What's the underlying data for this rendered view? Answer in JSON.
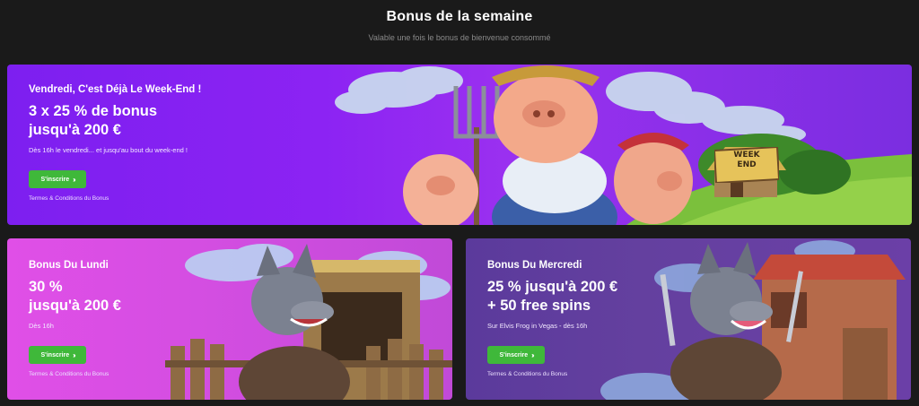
{
  "header": {
    "title": "Bonus de la semaine",
    "subtitle": "Valable une fois le bonus de bienvenue consommé"
  },
  "cards": [
    {
      "subtitle": "Vendredi, C'est Déjà Le Week-End !",
      "title_line1": "3 x 25 % de bonus",
      "title_line2": "jusqu'à 200 €",
      "description": "Dès 16h le vendredi... et jusqu'au bout du week-end !",
      "button_label": "S'inscrire",
      "terms_label": "Termes & Conditions du Bonus",
      "sign_text_1": "WEEK",
      "sign_text_2": "END",
      "bg_color": "#8a24f2"
    },
    {
      "subtitle": "Bonus Du Lundi",
      "title_line1": "30 %",
      "title_line2": "jusqu'à 200 €",
      "description": "Dès 16h",
      "button_label": "S'inscrire",
      "terms_label": "Termes & Conditions du Bonus",
      "bg_color": "#d74de3"
    },
    {
      "subtitle": "Bonus Du Mercredi",
      "title_line1": "25 % jusqu'à 200 €",
      "title_line2": "+ 50 free spins",
      "description": "Sur Elvis Frog in Vegas - dès 16h",
      "button_label": "S'inscrire",
      "terms_label": "Termes & Conditions du Bonus",
      "bg_color": "#62409f"
    }
  ],
  "icons": {
    "button_chevron": "double-chevron-right-icon"
  },
  "accent": {
    "button_green": "#3fb83a"
  }
}
